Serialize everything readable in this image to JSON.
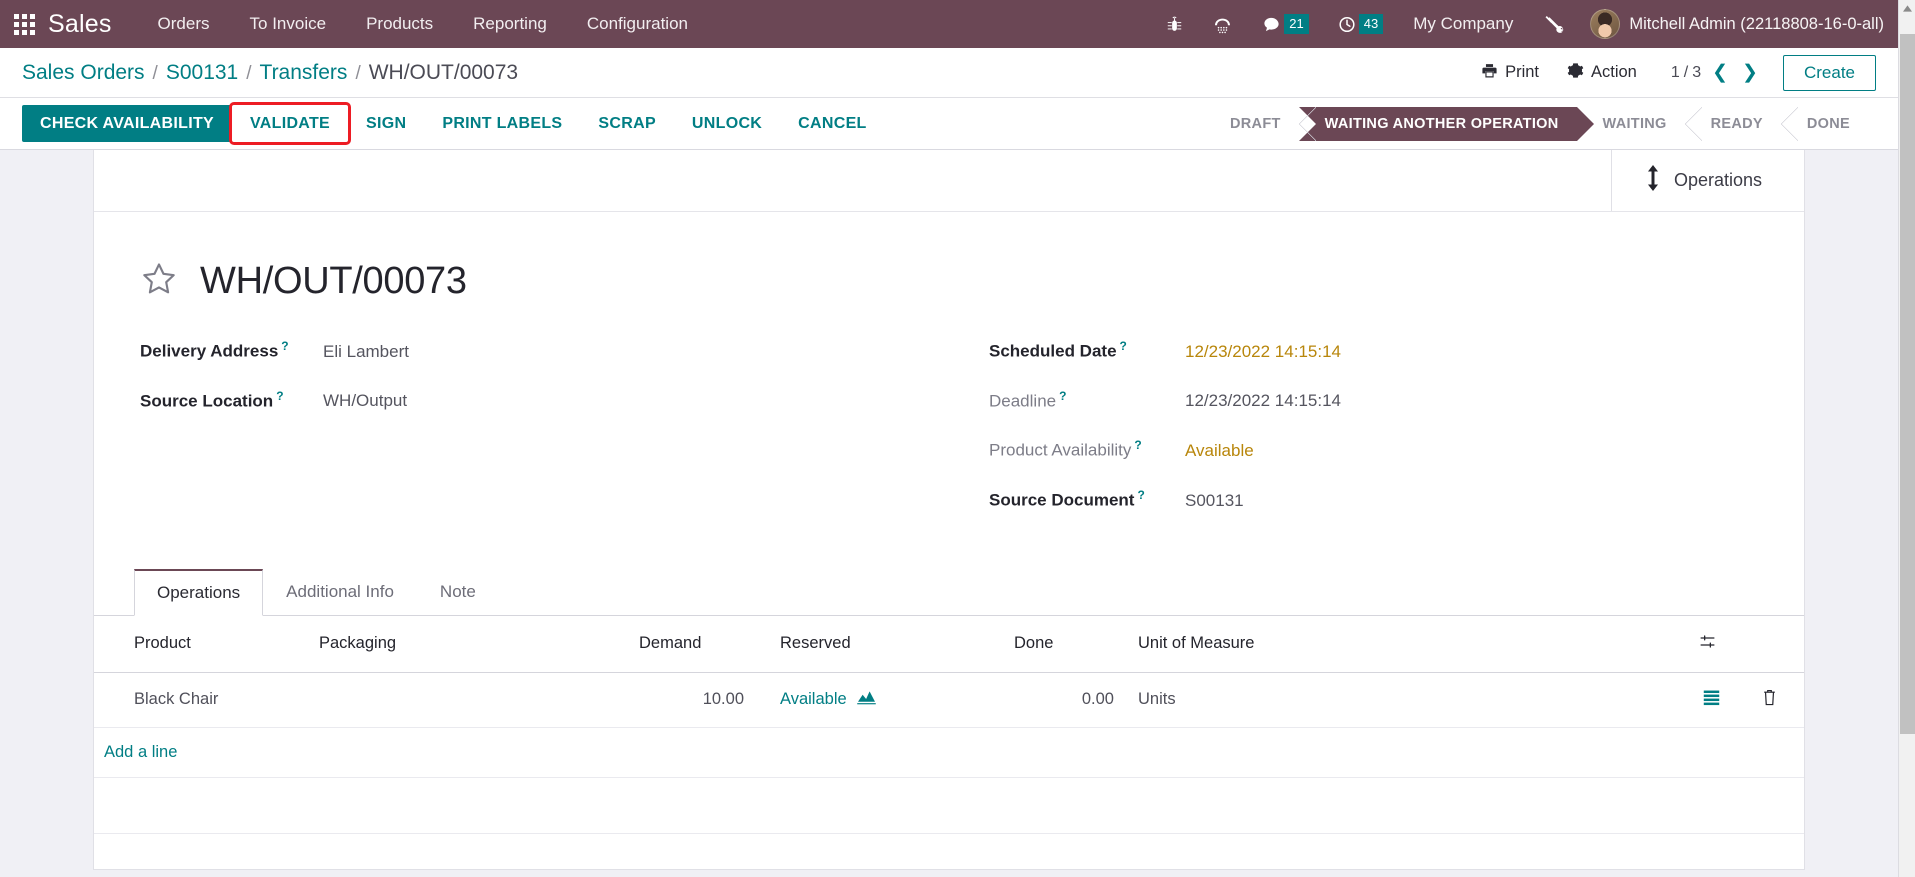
{
  "navbar": {
    "apps_icon": "apps-grid-icon",
    "brand": "Sales",
    "menus": [
      "Orders",
      "To Invoice",
      "Products",
      "Reporting",
      "Configuration"
    ],
    "icons": [
      {
        "name": "bug-icon",
        "badge": null
      },
      {
        "name": "dialpad-phone-icon",
        "badge": null
      },
      {
        "name": "messages-chat-icon",
        "badge": "21"
      },
      {
        "name": "activities-clock-icon",
        "badge": "43"
      }
    ],
    "company": "My Company",
    "tools_icon": "tools-wrench-screwdriver-icon",
    "user": "Mitchell Admin (22118808-16-0-all)",
    "bg_color": "#6b4755",
    "badge_color": "#017e84"
  },
  "controlpanel": {
    "breadcrumb": [
      {
        "label": "Sales Orders",
        "link": true
      },
      {
        "label": "S00131",
        "link": true
      },
      {
        "label": "Transfers",
        "link": true
      },
      {
        "label": "WH/OUT/00073",
        "link": false
      }
    ],
    "separator": "/",
    "print_label": "Print",
    "print_icon": "printer-icon",
    "action_label": "Action",
    "action_icon": "gear-icon",
    "pager": {
      "current": "1",
      "divider": "/",
      "total": "3"
    },
    "prev_icon": "chevron-left-icon",
    "next_icon": "chevron-right-icon",
    "create_label": "Create"
  },
  "statusbar_buttons": [
    {
      "label": "CHECK AVAILABILITY",
      "style": "primary",
      "highlighted": false
    },
    {
      "label": "VALIDATE",
      "style": "link",
      "highlighted": true
    },
    {
      "label": "SIGN",
      "style": "link",
      "highlighted": false
    },
    {
      "label": "PRINT LABELS",
      "style": "link",
      "highlighted": false
    },
    {
      "label": "SCRAP",
      "style": "link",
      "highlighted": false
    },
    {
      "label": "UNLOCK",
      "style": "link",
      "highlighted": false
    },
    {
      "label": "CANCEL",
      "style": "link",
      "highlighted": false
    }
  ],
  "status_stages": [
    {
      "label": "DRAFT",
      "active": false
    },
    {
      "label": "WAITING ANOTHER OPERATION",
      "active": true
    },
    {
      "label": "WAITING",
      "active": false
    },
    {
      "label": "READY",
      "active": false
    },
    {
      "label": "DONE",
      "active": false
    }
  ],
  "accent_colors": {
    "teal": "#017e84",
    "purple": "#6b4755",
    "amber": "#b8860b",
    "highlight_red": "#ed1c24"
  },
  "smart_buttons": [
    {
      "label": "Operations",
      "icon": "arrows-up-down-icon"
    }
  ],
  "record": {
    "star_icon": "star-outline-icon",
    "title": "WH/OUT/00073",
    "left_fields": [
      {
        "label": "Delivery Address",
        "help": "?",
        "value": "Eli Lambert",
        "bold_label": true
      },
      {
        "label": "Source Location",
        "help": "?",
        "value": "WH/Output",
        "bold_label": true
      }
    ],
    "right_fields": [
      {
        "label": "Scheduled Date",
        "help": "?",
        "value": "12/23/2022 14:15:14",
        "bold_label": true,
        "accent": true
      },
      {
        "label": "Deadline",
        "help": "?",
        "value": "12/23/2022 14:15:14",
        "bold_label": false,
        "accent": false
      },
      {
        "label": "Product Availability",
        "help": "?",
        "value": "Available",
        "bold_label": false,
        "accent": true
      },
      {
        "label": "Source Document",
        "help": "?",
        "value": "S00131",
        "bold_label": true,
        "accent": false
      }
    ]
  },
  "notebook": {
    "tabs": [
      {
        "label": "Operations",
        "active": true
      },
      {
        "label": "Additional Info",
        "active": false
      },
      {
        "label": "Note",
        "active": false
      }
    ],
    "table": {
      "columns": [
        "Product",
        "Packaging",
        "Demand",
        "Reserved",
        "Done",
        "Unit of Measure"
      ],
      "optional_columns_icon": "column-settings-sliders-icon",
      "rows": [
        {
          "product": "Black Chair",
          "packaging": "",
          "demand": "10.00",
          "reserved": "Available",
          "reserved_icon": "forecast-area-chart-icon",
          "done": "0.00",
          "uom": "Units",
          "detail_icon": "detailed-operations-list-icon",
          "delete_icon": "trash-delete-icon"
        }
      ],
      "add_line_label": "Add a line"
    }
  },
  "scrollbar": {
    "up_arrow_icon": "scroll-up-arrow-icon",
    "thumb": "vertical-scroll-thumb"
  }
}
